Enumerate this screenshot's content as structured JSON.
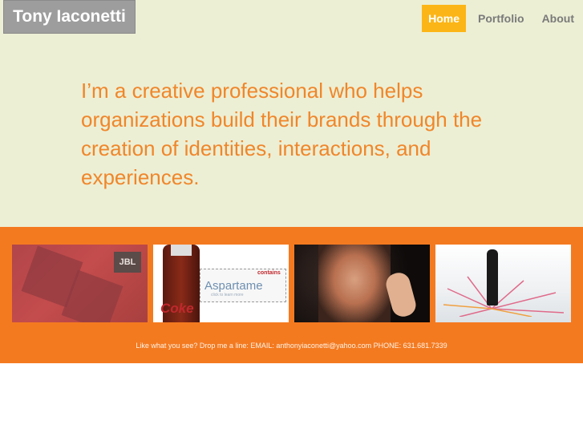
{
  "header": {
    "logo_text": "Tony Iaconetti",
    "nav": [
      {
        "label": "Home",
        "active": true
      },
      {
        "label": "Portfolio",
        "active": false
      },
      {
        "label": "About",
        "active": false
      }
    ]
  },
  "hero": {
    "tagline": "I’m a creative professional who helps organizations build their brands through the creation of identities, interactions, and experiences."
  },
  "gallery": {
    "thumb1": {
      "badge": "JBL"
    },
    "thumb2": {
      "brand": "Coke",
      "contains": "contains",
      "product": "Aspartame",
      "cta": "click to learn more"
    }
  },
  "footer": {
    "contact": "Like what you see? Drop me a line: EMAIL: anthonyiaconetti@yahoo.com PHONE: 631.681.7339"
  },
  "colors": {
    "hero_bg": "#ecefd4",
    "accent_orange": "#f47a20",
    "nav_active": "#fcb516",
    "logo_bg": "#9d9d9d"
  }
}
